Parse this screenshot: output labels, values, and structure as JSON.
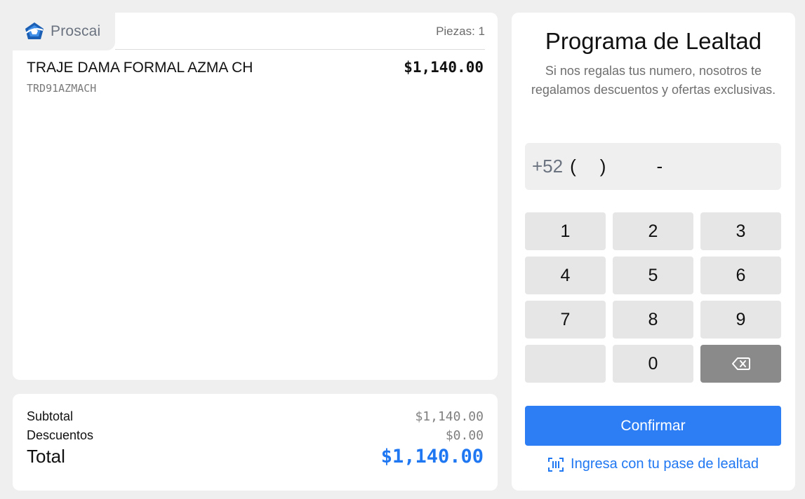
{
  "brand": {
    "name": "Proscai",
    "logo_icon": "proscai-logo-icon"
  },
  "receipt": {
    "pieces_label": "Piezas: 1",
    "items": [
      {
        "name": "TRAJE DAMA FORMAL AZMA CH",
        "price": "$1,140.00",
        "sku": "TRD91AZMACH"
      }
    ]
  },
  "totals": {
    "subtotal_label": "Subtotal",
    "subtotal_value": "$1,140.00",
    "discounts_label": "Descuentos",
    "discounts_value": "$0.00",
    "total_label": "Total",
    "total_value": "$1,140.00"
  },
  "loyalty": {
    "title": "Programa de Lealtad",
    "subtitle": "Si nos regalas tus numero, nosotros te regalamos descuentos y ofertas exclusivas.",
    "phone": {
      "prefix": "+52",
      "open_paren": "(",
      "close_paren": ")",
      "dash": "-"
    },
    "keypad": {
      "k1": "1",
      "k2": "2",
      "k3": "3",
      "k4": "4",
      "k5": "5",
      "k6": "6",
      "k7": "7",
      "k8": "8",
      "k9": "9",
      "k0": "0",
      "backspace_icon": "backspace-icon"
    },
    "confirm_label": "Confirmar",
    "pass_link_label": "Ingresa con tu pase de lealtad",
    "pass_icon": "barcode-scan-icon"
  },
  "colors": {
    "accent": "#2d7ef5",
    "total_blue": "#1f77f2",
    "background": "#efefef"
  }
}
